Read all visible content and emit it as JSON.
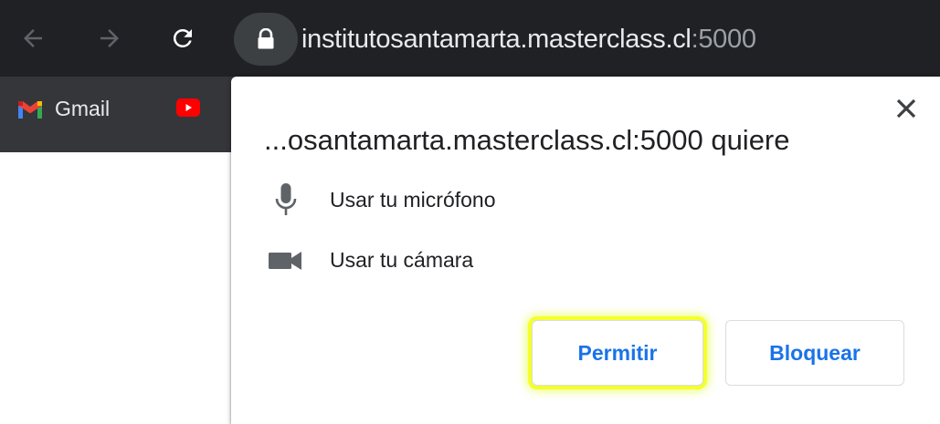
{
  "toolbar": {
    "back_icon": "arrow-left-icon",
    "forward_icon": "arrow-right-icon",
    "reload_icon": "reload-icon",
    "lock_icon": "lock-icon"
  },
  "omnibox": {
    "host": "institutosantamarta.masterclass.cl",
    "port": ":5000"
  },
  "bookmarks": [
    {
      "label": "Gmail",
      "icon": "gmail-icon"
    },
    {
      "label": "",
      "icon": "youtube-icon"
    }
  ],
  "permission_popup": {
    "title": "...osantamarta.masterclass.cl:5000 quiere",
    "permissions": [
      {
        "label": "Usar tu micrófono",
        "icon": "microphone-icon"
      },
      {
        "label": "Usar tu cámara",
        "icon": "camera-icon"
      }
    ],
    "allow_label": "Permitir",
    "block_label": "Bloquear",
    "close_icon": "close-icon"
  },
  "colors": {
    "toolbar_bg": "#202124",
    "bookmarks_bg": "#35363a",
    "button_text": "#1a73e8",
    "highlight": "#f5ff2a"
  }
}
